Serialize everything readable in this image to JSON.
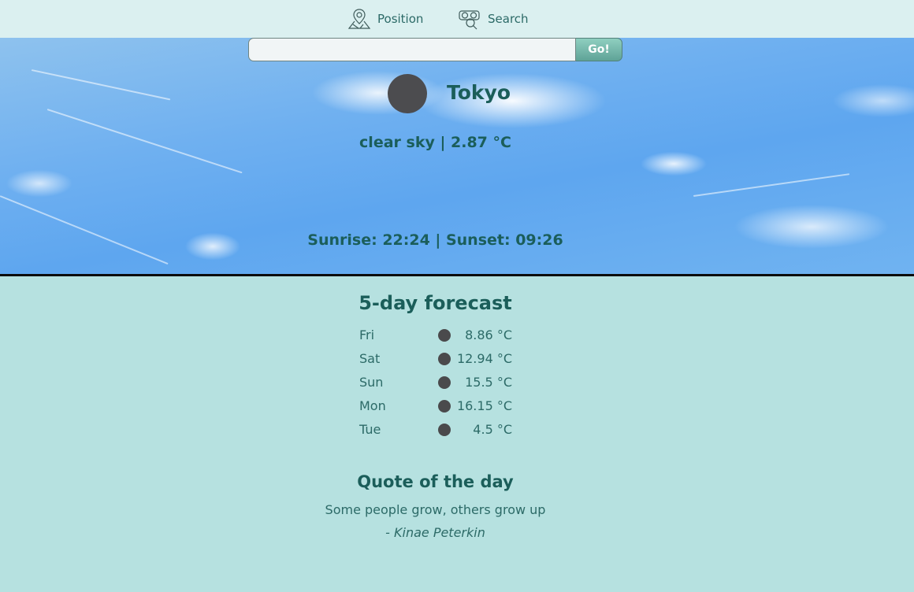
{
  "nav": {
    "position_label": "Position",
    "search_label": "Search"
  },
  "search": {
    "value": "",
    "placeholder": "",
    "go_label": "Go!"
  },
  "weather": {
    "city": "Tokyo",
    "description": "clear sky | 2.87 °C",
    "sun_times": "Sunrise: 22:24 |  Sunset: 09:26"
  },
  "forecast": {
    "title": "5-day forecast",
    "days": [
      {
        "day": "Fri",
        "temp": "8.86 °C"
      },
      {
        "day": "Sat",
        "temp": "12.94 °C"
      },
      {
        "day": "Sun",
        "temp": "15.5 °C"
      },
      {
        "day": "Mon",
        "temp": "16.15 °C"
      },
      {
        "day": "Tue",
        "temp": "4.5 °C"
      }
    ]
  },
  "quote": {
    "title": "Quote of the day",
    "text": "Some people grow, others grow up",
    "author": "- Kinae Peterkin"
  },
  "colors": {
    "nav_bg": "#dbf0f0",
    "page_bg": "#b6e1e0",
    "text": "#1b5e5a",
    "go_button": "#6fb3a6",
    "icon_placeholder": "#4c4c4f"
  },
  "icons": {
    "position": "map-pin-icon",
    "search": "binoculars-search-icon",
    "weather": "weather-icon"
  }
}
